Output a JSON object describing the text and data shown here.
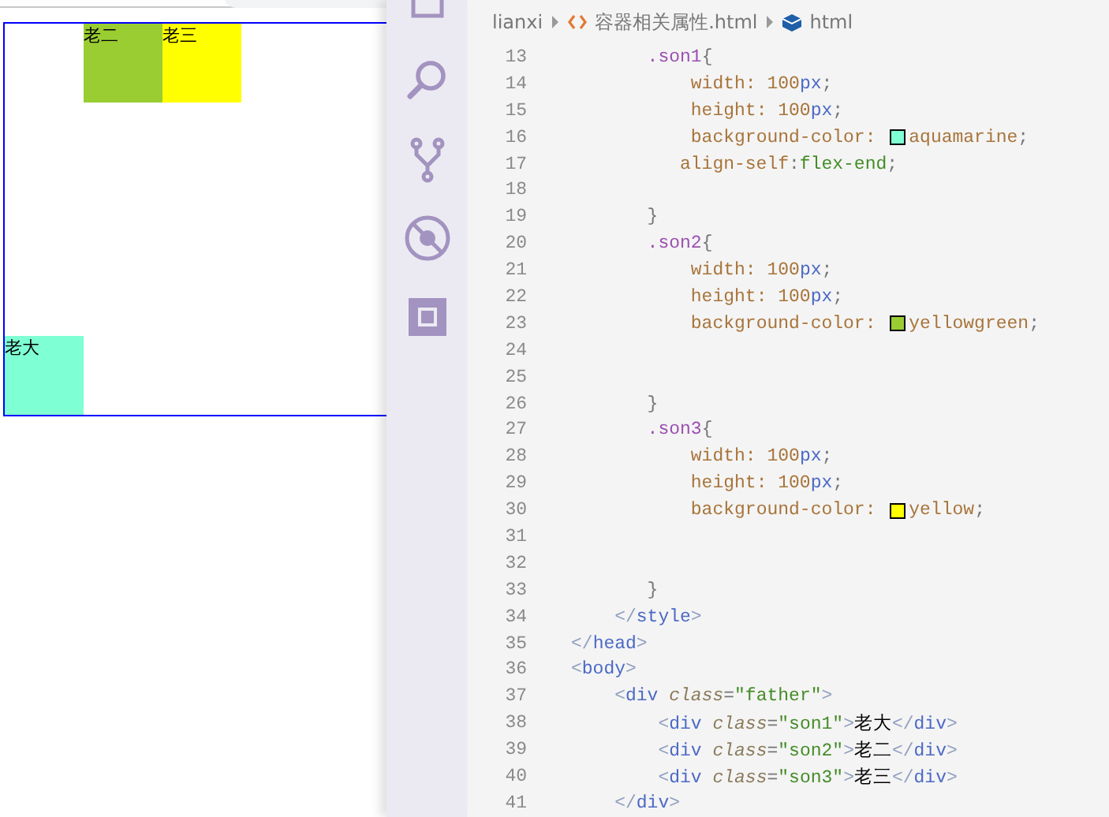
{
  "preview": {
    "boxes": [
      {
        "label": "老大",
        "color": "#7fffd4",
        "kind": "bottom"
      },
      {
        "label": "老二",
        "color": "#9acd32",
        "kind": "top"
      },
      {
        "label": "老三",
        "color": "#ffff00",
        "kind": "top"
      }
    ]
  },
  "breadcrumbs": [
    {
      "kind": "folder",
      "text": "lianxi"
    },
    {
      "kind": "file",
      "text": "容器相关属性.html"
    },
    {
      "kind": "symbol",
      "text": "html"
    }
  ],
  "lines": [
    {
      "n": "13",
      "kind": "selector",
      "tokens": [
        {
          "kind": "sel",
          "text": ".son1"
        },
        {
          "kind": "punct",
          "text": "{"
        }
      ]
    },
    {
      "n": "14",
      "kind": "decl",
      "tokens": [
        {
          "kind": "prop",
          "text": "width: "
        },
        {
          "kind": "num",
          "text": "100"
        },
        {
          "kind": "unit",
          "text": "px"
        },
        {
          "kind": "punct",
          "text": ";"
        }
      ]
    },
    {
      "n": "15",
      "kind": "decl",
      "tokens": [
        {
          "kind": "prop",
          "text": "height: "
        },
        {
          "kind": "num",
          "text": "100"
        },
        {
          "kind": "unit",
          "text": "px"
        },
        {
          "kind": "punct",
          "text": ";"
        }
      ]
    },
    {
      "n": "16",
      "kind": "decl",
      "tokens": [
        {
          "kind": "prop",
          "text": "background-color: "
        },
        {
          "kind": "swatch",
          "color": "#7fffd4"
        },
        {
          "kind": "value",
          "text": "aquamarine"
        },
        {
          "kind": "punct",
          "text": ";"
        }
      ]
    },
    {
      "n": "17",
      "kind": "loose",
      "tokens": [
        {
          "kind": "prop",
          "text": "align-self"
        },
        {
          "kind": "punct",
          "text": ":"
        },
        {
          "kind": "kw",
          "text": "flex-end"
        },
        {
          "kind": "punct",
          "text": ";"
        }
      ]
    },
    {
      "n": "18",
      "kind": "blank"
    },
    {
      "n": "19",
      "kind": "selector",
      "tokens": [
        {
          "kind": "punct",
          "text": "}"
        }
      ]
    },
    {
      "n": "20",
      "kind": "selector",
      "tokens": [
        {
          "kind": "sel",
          "text": ".son2"
        },
        {
          "kind": "punct",
          "text": "{"
        }
      ]
    },
    {
      "n": "21",
      "kind": "decl",
      "tokens": [
        {
          "kind": "prop",
          "text": "width: "
        },
        {
          "kind": "num",
          "text": "100"
        },
        {
          "kind": "unit",
          "text": "px"
        },
        {
          "kind": "punct",
          "text": ";"
        }
      ]
    },
    {
      "n": "22",
      "kind": "decl",
      "tokens": [
        {
          "kind": "prop",
          "text": "height: "
        },
        {
          "kind": "num",
          "text": "100"
        },
        {
          "kind": "unit",
          "text": "px"
        },
        {
          "kind": "punct",
          "text": ";"
        }
      ]
    },
    {
      "n": "23",
      "kind": "decl",
      "tokens": [
        {
          "kind": "prop",
          "text": "background-color: "
        },
        {
          "kind": "swatch",
          "color": "#9acd32"
        },
        {
          "kind": "value",
          "text": "yellowgreen"
        },
        {
          "kind": "punct",
          "text": ";"
        }
      ]
    },
    {
      "n": "24",
      "kind": "blank"
    },
    {
      "n": "25",
      "kind": "blank"
    },
    {
      "n": "26",
      "kind": "selector",
      "tokens": [
        {
          "kind": "punct",
          "text": "}"
        }
      ]
    },
    {
      "n": "27",
      "kind": "selector",
      "tokens": [
        {
          "kind": "sel",
          "text": ".son3"
        },
        {
          "kind": "punct",
          "text": "{"
        }
      ]
    },
    {
      "n": "28",
      "kind": "decl",
      "tokens": [
        {
          "kind": "prop",
          "text": "width: "
        },
        {
          "kind": "num",
          "text": "100"
        },
        {
          "kind": "unit",
          "text": "px"
        },
        {
          "kind": "punct",
          "text": ";"
        }
      ]
    },
    {
      "n": "29",
      "kind": "decl",
      "tokens": [
        {
          "kind": "prop",
          "text": "height: "
        },
        {
          "kind": "num",
          "text": "100"
        },
        {
          "kind": "unit",
          "text": "px"
        },
        {
          "kind": "punct",
          "text": ";"
        }
      ]
    },
    {
      "n": "30",
      "kind": "decl",
      "tokens": [
        {
          "kind": "prop",
          "text": "background-color: "
        },
        {
          "kind": "swatch",
          "color": "#ffff00"
        },
        {
          "kind": "value",
          "text": "yellow"
        },
        {
          "kind": "punct",
          "text": ";"
        }
      ]
    },
    {
      "n": "31",
      "kind": "blank"
    },
    {
      "n": "32",
      "kind": "blank"
    },
    {
      "n": "33",
      "kind": "selector",
      "tokens": [
        {
          "kind": "punct",
          "text": "}"
        }
      ]
    },
    {
      "n": "34",
      "kind": "outer",
      "tokens": [
        {
          "kind": "tagp",
          "text": "</"
        },
        {
          "kind": "tag",
          "text": "style"
        },
        {
          "kind": "tagp",
          "text": ">"
        }
      ]
    },
    {
      "n": "35",
      "kind": "root",
      "tokens": [
        {
          "kind": "tagp",
          "text": "</"
        },
        {
          "kind": "tag",
          "text": "head"
        },
        {
          "kind": "tagp",
          "text": ">"
        }
      ]
    },
    {
      "n": "36",
      "kind": "root",
      "tokens": [
        {
          "kind": "tagp",
          "text": "<"
        },
        {
          "kind": "tag",
          "text": "body"
        },
        {
          "kind": "tagp",
          "text": ">"
        }
      ]
    },
    {
      "n": "37",
      "kind": "outer",
      "tokens": [
        {
          "kind": "tagp",
          "text": "<"
        },
        {
          "kind": "tag",
          "text": "div "
        },
        {
          "kind": "attr",
          "text": "class"
        },
        {
          "kind": "punct",
          "text": "="
        },
        {
          "kind": "str",
          "text": "\"father\""
        },
        {
          "kind": "tagp",
          "text": ">"
        }
      ]
    },
    {
      "n": "38",
      "kind": "inner",
      "tokens": [
        {
          "kind": "tagp",
          "text": "<"
        },
        {
          "kind": "tag",
          "text": "div "
        },
        {
          "kind": "attr",
          "text": "class"
        },
        {
          "kind": "punct",
          "text": "="
        },
        {
          "kind": "str",
          "text": "\"son1\""
        },
        {
          "kind": "tagp",
          "text": ">"
        },
        {
          "kind": "txt",
          "text": "老大"
        },
        {
          "kind": "tagp",
          "text": "</"
        },
        {
          "kind": "tag",
          "text": "div"
        },
        {
          "kind": "tagp",
          "text": ">"
        }
      ]
    },
    {
      "n": "39",
      "kind": "inner",
      "tokens": [
        {
          "kind": "tagp",
          "text": "<"
        },
        {
          "kind": "tag",
          "text": "div "
        },
        {
          "kind": "attr",
          "text": "class"
        },
        {
          "kind": "punct",
          "text": "="
        },
        {
          "kind": "str",
          "text": "\"son2\""
        },
        {
          "kind": "tagp",
          "text": ">"
        },
        {
          "kind": "txt",
          "text": "老二"
        },
        {
          "kind": "tagp",
          "text": "</"
        },
        {
          "kind": "tag",
          "text": "div"
        },
        {
          "kind": "tagp",
          "text": ">"
        }
      ]
    },
    {
      "n": "40",
      "kind": "inner",
      "tokens": [
        {
          "kind": "tagp",
          "text": "<"
        },
        {
          "kind": "tag",
          "text": "div "
        },
        {
          "kind": "attr",
          "text": "class"
        },
        {
          "kind": "punct",
          "text": "="
        },
        {
          "kind": "str",
          "text": "\"son3\""
        },
        {
          "kind": "tagp",
          "text": ">"
        },
        {
          "kind": "txt",
          "text": "老三"
        },
        {
          "kind": "tagp",
          "text": "</"
        },
        {
          "kind": "tag",
          "text": "div"
        },
        {
          "kind": "tagp",
          "text": ">"
        }
      ]
    },
    {
      "n": "41",
      "kind": "outer",
      "tokens": [
        {
          "kind": "tagp",
          "text": "</"
        },
        {
          "kind": "tag",
          "text": "div"
        },
        {
          "kind": "tagp",
          "text": ">"
        }
      ]
    }
  ]
}
